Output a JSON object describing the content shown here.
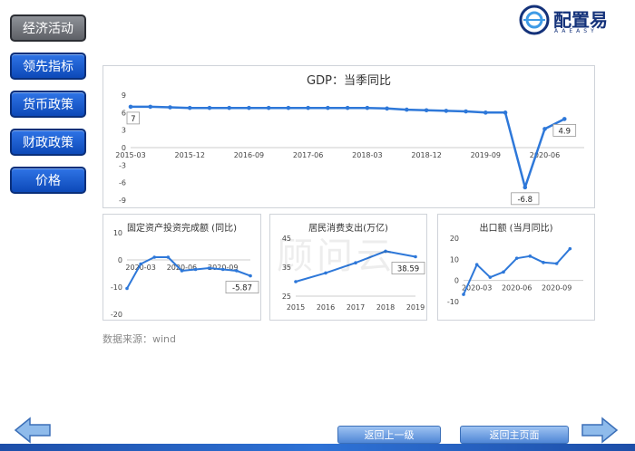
{
  "nav": [
    {
      "label": "经济活动",
      "active": true
    },
    {
      "label": "领先指标",
      "active": false
    },
    {
      "label": "货币政策",
      "active": false
    },
    {
      "label": "财政政策",
      "active": false
    },
    {
      "label": "价格",
      "active": false
    }
  ],
  "logo": {
    "text": "配置易",
    "subtitle": "AAEASY"
  },
  "source": "数据来源：wind",
  "buttons": {
    "back": "返回上一级",
    "home": "返回主页面"
  },
  "watermark": "顾问云",
  "colors": {
    "series": "#2e78d9",
    "nav_blue": "#1a5fd0",
    "nav_active": "#7a7d83",
    "bottom_bar": "#2a66c6"
  },
  "chart_data": [
    {
      "type": "line",
      "title": "GDP：当季同比",
      "x": [
        "2015-03",
        "2015-06",
        "2015-09",
        "2015-12",
        "2016-03",
        "2016-06",
        "2016-09",
        "2016-12",
        "2017-03",
        "2017-06",
        "2017-09",
        "2017-12",
        "2018-03",
        "2018-06",
        "2018-09",
        "2018-12",
        "2019-03",
        "2019-06",
        "2019-09",
        "2019-12",
        "2020-03",
        "2020-06",
        "2020-09",
        "2020-12"
      ],
      "values": [
        7.0,
        7.0,
        6.9,
        6.8,
        6.8,
        6.8,
        6.8,
        6.8,
        6.8,
        6.8,
        6.8,
        6.8,
        6.8,
        6.7,
        6.5,
        6.4,
        6.3,
        6.2,
        6.0,
        6.0,
        -6.8,
        3.2,
        4.9,
        null
      ],
      "xticks": [
        "2015-03",
        "2015-12",
        "2016-09",
        "2017-06",
        "2018-03",
        "2018-12",
        "2019-09",
        "2020-06"
      ],
      "yticks": [
        9,
        6,
        3,
        0,
        -3,
        -6,
        -9
      ],
      "ylim": [
        -9,
        9
      ],
      "data_labels": [
        {
          "x": "2015-03",
          "text": "7"
        },
        {
          "x": "2020-03",
          "text": "-6.8"
        },
        {
          "x": "2020-09",
          "text": "4.9"
        }
      ]
    },
    {
      "type": "line",
      "title": "固定资产投资完成额 (同比)",
      "x": [
        "2020-02",
        "2020-03",
        "2020-04",
        "2020-05",
        "2020-06",
        "2020-07",
        "2020-08",
        "2020-09",
        "2020-10",
        "2020-11"
      ],
      "values": [
        -10.5,
        -1.5,
        1.0,
        1.0,
        -4.0,
        -3.5,
        -3.0,
        -3.5,
        -4.0,
        -5.87
      ],
      "xticks": [
        "2020-03",
        "2020-06",
        "2020-09"
      ],
      "yticks": [
        10,
        0,
        -10,
        -20
      ],
      "ylim": [
        -20,
        10
      ],
      "data_labels": [
        {
          "x": "2020-11",
          "text": "-5.87"
        }
      ]
    },
    {
      "type": "line",
      "title": "居民消费支出(万亿)",
      "x": [
        "2015",
        "2016",
        "2017",
        "2018",
        "2019"
      ],
      "values": [
        30.0,
        33.0,
        36.5,
        40.5,
        38.59
      ],
      "xticks": [
        "2015",
        "2016",
        "2017",
        "2018",
        "2019"
      ],
      "yticks": [
        45,
        35,
        25
      ],
      "ylim": [
        25,
        45
      ],
      "data_labels": [
        {
          "x": "2019",
          "text": "38.59"
        }
      ]
    },
    {
      "type": "line",
      "title": "出口额 (当月同比)",
      "x": [
        "2020-02",
        "2020-03",
        "2020-04",
        "2020-05",
        "2020-06",
        "2020-07",
        "2020-08",
        "2020-09",
        "2020-10",
        "2020-11"
      ],
      "values": [
        -6.6,
        7.5,
        1.5,
        4.0,
        10.5,
        11.5,
        8.5,
        8.0,
        15.0,
        null
      ],
      "xticks": [
        "2020-03",
        "2020-06",
        "2020-09"
      ],
      "yticks": [
        20,
        10,
        0,
        -10
      ],
      "ylim": [
        -10,
        20
      ],
      "data_labels": []
    }
  ]
}
